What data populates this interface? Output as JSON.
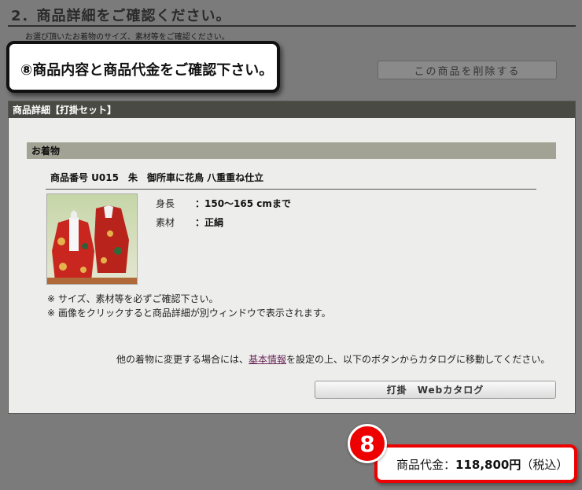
{
  "header": {
    "title": "2．商品詳細をご確認ください。",
    "subtitle": "お選び頂いたお着物のサイズ、素材等をご確認ください。"
  },
  "callout": {
    "text": "⑧商品内容と商品代金をご確認下さい。"
  },
  "delete_button": {
    "label": "この商品を削除する"
  },
  "panel": {
    "header": "商品詳細【打掛セット】",
    "section": "お着物",
    "item_name": "商品番号 U015　朱　御所車に花鳥 八重重ね仕立",
    "image_icon": "kimono-photo",
    "specs": [
      {
        "label": "身長",
        "value": "：150～165 cmまで"
      },
      {
        "label": "素材",
        "value": "：正絹"
      }
    ],
    "notes": [
      "※ サイズ、素材等を必ずご確認下さい。",
      "※ 画像をクリックすると商品詳細が別ウィンドウで表示されます。"
    ],
    "catalog_before": "他の着物に変更する場合には、",
    "catalog_link": "基本情報",
    "catalog_after": "を設定の上、以下のボタンからカタログに移動してください。",
    "catalog_button": "打掛　Webカタログ"
  },
  "price": {
    "badge": "8",
    "label": "商品代金：",
    "amount": "118,800円",
    "tax": "（税込）"
  },
  "colors": {
    "accent": "#e00000",
    "panel_header": "#4a4a44",
    "section_bar": "#a3a395"
  }
}
